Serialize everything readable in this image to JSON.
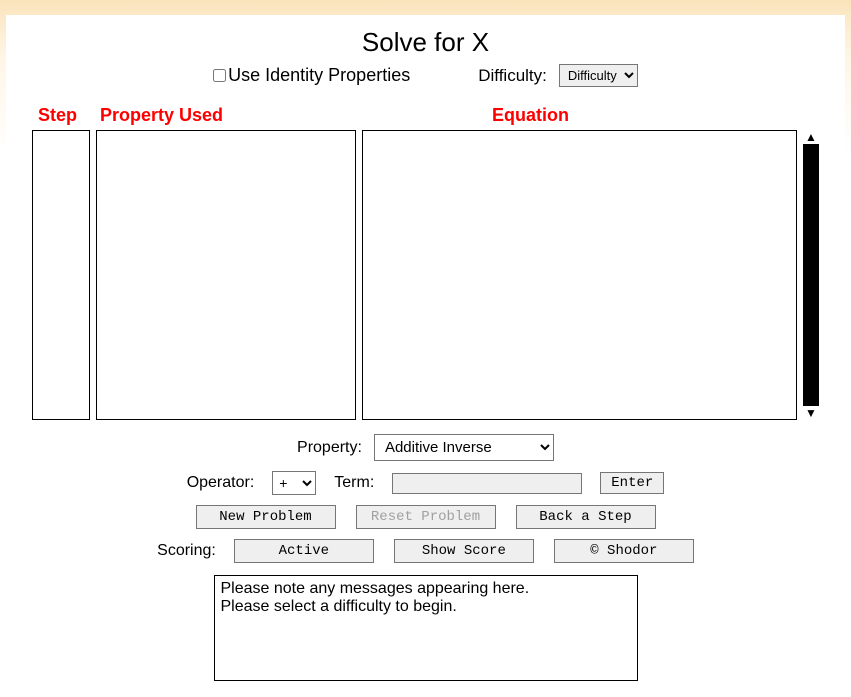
{
  "title": "Solve for X",
  "identity": {
    "label": "Use Identity Properties",
    "checked": false
  },
  "difficulty": {
    "label": "Difficulty:",
    "selected": "Difficulty"
  },
  "columns": {
    "step": "Step",
    "property": "Property Used",
    "equation": "Equation"
  },
  "property": {
    "label": "Property:",
    "selected": "Additive Inverse"
  },
  "operator": {
    "label": "Operator:",
    "selected": "+"
  },
  "term": {
    "label": "Term:",
    "value": ""
  },
  "buttons": {
    "enter": "Enter",
    "newProblem": "New Problem",
    "resetProblem": "Reset Problem",
    "backStep": "Back a Step",
    "active": "Active",
    "showScore": "Show Score",
    "shodor": "© Shodor"
  },
  "scoringLabel": "Scoring:",
  "message": "Please note any messages appearing here.\nPlease select a difficulty to begin."
}
